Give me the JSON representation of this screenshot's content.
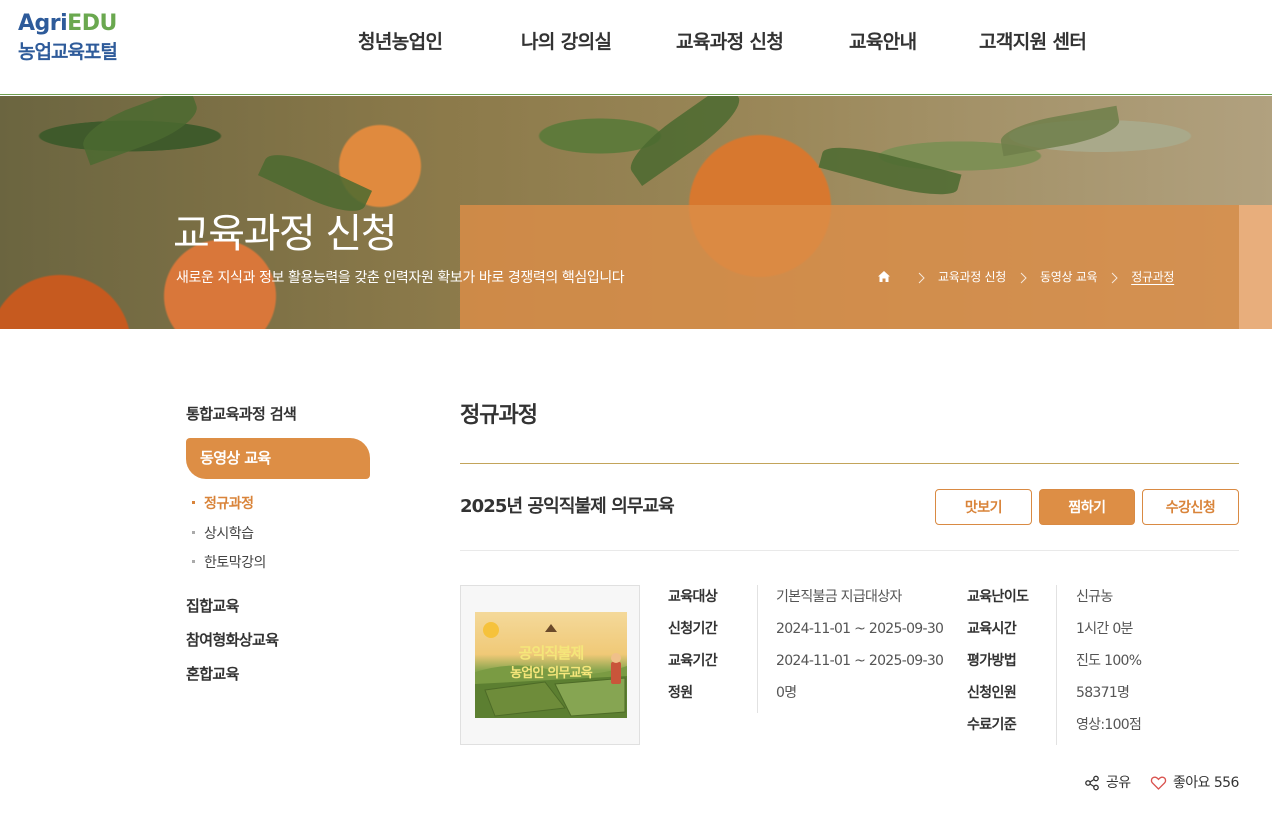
{
  "header": {
    "logo": {
      "line1_a": "Agri",
      "line1_b": "EDU",
      "line2": "농업교육포털"
    },
    "nav": [
      "청년농업인",
      "나의 강의실",
      "교육과정 신청",
      "교육안내",
      "고객지원 센터"
    ]
  },
  "hero": {
    "title": "교육과정 신청",
    "subtitle": "새로운 지식과 정보 활용능력을 갖춘 인력자원 확보가 바로 경쟁력의 핵심입니다",
    "breadcrumb": [
      "교육과정 신청",
      "동영상 교육",
      "정규과정"
    ]
  },
  "sidebar": {
    "top_link": "통합교육과정 검색",
    "active": "동영상 교육",
    "sub_items": [
      "정규과정",
      "상시학습",
      "한토막강의"
    ],
    "links": [
      "집합교육",
      "참여형화상교육",
      "혼합교육"
    ]
  },
  "main": {
    "page_title": "정규과정",
    "course": {
      "title": "2025년 공익직불제 의무교육",
      "buttons": {
        "preview": "맛보기",
        "wish": "찜하기",
        "apply": "수강신청"
      },
      "thumbnail": {
        "line1": "공익직불제",
        "line2": "농업인 의무교육"
      },
      "info_left": [
        {
          "label": "교육대상",
          "value": "기본직불금 지급대상자"
        },
        {
          "label": "신청기간",
          "value": "2024-11-01 ~ 2025-09-30"
        },
        {
          "label": "교육기간",
          "value": "2024-11-01 ~ 2025-09-30"
        },
        {
          "label": "정원",
          "value": "0명"
        }
      ],
      "info_right": [
        {
          "label": "교육난이도",
          "value": "신규농"
        },
        {
          "label": "교육시간",
          "value": "1시간 0분"
        },
        {
          "label": "평가방법",
          "value": "진도 100%"
        },
        {
          "label": "신청인원",
          "value": "58371명"
        },
        {
          "label": "수료기준",
          "value": "영상:100점"
        }
      ]
    },
    "actions": {
      "share": "공유",
      "like_label": "좋아요",
      "like_count": "556"
    }
  },
  "colors": {
    "accent": "#dd8e45",
    "brand_blue": "#2e5b9a",
    "brand_green": "#6aa84f"
  }
}
